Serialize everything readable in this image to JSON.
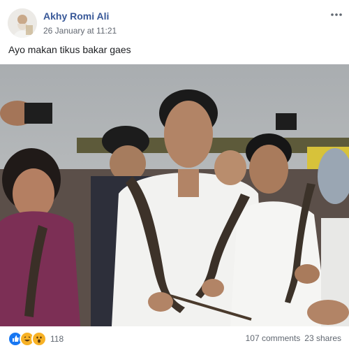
{
  "post": {
    "author": "Akhy Romi Ali",
    "timestamp": "26 January at 11:21",
    "text": "Ayo makan tikus bakar gaes"
  },
  "photo": {
    "alt_icon": "photo"
  },
  "footer": {
    "reaction_icons": [
      "like-icon",
      "haha-icon",
      "wow-icon"
    ],
    "reaction_count": "118",
    "comments": "107 comments",
    "shares": "23 shares"
  },
  "colors": {
    "author_link": "#385898",
    "secondary_text": "#616770",
    "like_blue": "#1877f2",
    "haha_yellow": "#f7b125"
  }
}
